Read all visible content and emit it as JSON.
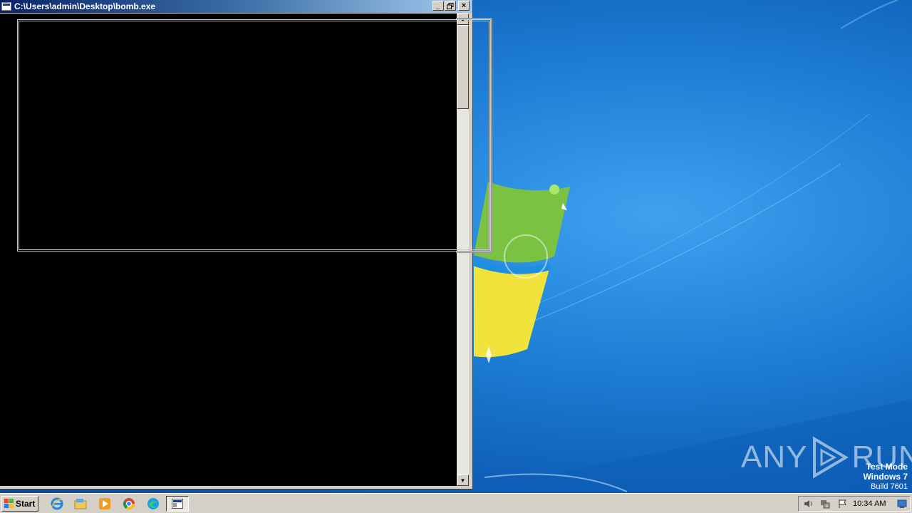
{
  "window": {
    "title": "C:\\Users\\admin\\Desktop\\bomb.exe",
    "minimize_label": "_",
    "maximize_label": "▫",
    "close_label": "×"
  },
  "console": {
    "scroll_up_glyph": "▲",
    "scroll_down_glyph": "▼"
  },
  "watermark": {
    "left_text": "ANY",
    "right_text": "RUN"
  },
  "os_notice": {
    "line1": "Test Mode",
    "line2": "Windows 7",
    "line3": "Build 7601"
  },
  "taskbar": {
    "start_label": "Start",
    "pinned": [
      "internet-explorer-icon",
      "file-explorer-icon",
      "media-player-icon",
      "chrome-icon",
      "edge-icon",
      "console-task-icon"
    ],
    "clock": "10:34 AM"
  },
  "colors": {
    "title_bar_start": "#0a246a",
    "title_bar_end": "#a6caf0",
    "console_bg": "#000000",
    "desktop_bg": "#1e7fd6"
  }
}
